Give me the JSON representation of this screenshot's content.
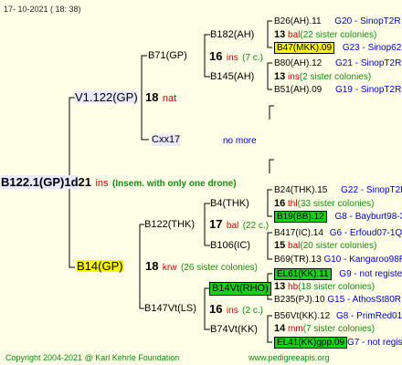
{
  "header": {
    "date": "17- 10-2021 ( 18: 38)"
  },
  "footer": {
    "copyright": "Copyright 2004-2021 @ Karl Kehrle Foundation",
    "url": "www.pedigreeapis.org"
  },
  "root": {
    "id": "B122.1(GP)1d",
    "num": "21",
    "code": "ins",
    "note": "(Insem. with only one drone)"
  },
  "gen1": {
    "top": {
      "id": "V1.122(GP)",
      "num": "18",
      "code": "nat"
    },
    "bottom": {
      "id": "B14(GP)",
      "num": "18",
      "code": "krw",
      "note": "(26 sister colonies)"
    }
  },
  "gen2": {
    "a": {
      "id": "B71(GP)",
      "num": "16",
      "code": "ins",
      "note": "(7 c.)"
    },
    "b": {
      "id": "Cxx17",
      "note": "no more"
    },
    "c": {
      "id": "B122(THK)",
      "num": "17",
      "code": "bal",
      "note": "(22 c.)"
    },
    "d": {
      "id": "B147Vt(LS)",
      "num": "16",
      "code": "ins",
      "note": "(2 c.)"
    }
  },
  "gen3": {
    "a1": {
      "id": "B182(AH)"
    },
    "a2": {
      "id": "B145(AH)"
    },
    "c1": {
      "id": "B4(THK)"
    },
    "c2": {
      "id": "B106(IC)"
    },
    "d1": {
      "id": "B14Vt(RHO)"
    },
    "d2": {
      "id": "B74Vt(KK)"
    }
  },
  "gen4": [
    {
      "id": "B26(AH).11",
      "tag": "G20 - SinopT2R"
    },
    {
      "num": "13",
      "code": "bal",
      "note": "(22 sister colonies)"
    },
    {
      "id": "B47(MKK).09",
      "tag": "G23 - Sinop62R"
    },
    {
      "id": "B80(AH).12",
      "tag": "G21 - SinopT2R"
    },
    {
      "num": "13",
      "code": "ins",
      "note": "(2 sister colonies)"
    },
    {
      "id": "B51(AH).09",
      "tag": "G19 - SinopT2R"
    },
    {
      "id": "B24(THK).15",
      "tag": "G22 - SinopT2R"
    },
    {
      "num": "16",
      "code": "thl",
      "note": "(33 sister colonies)"
    },
    {
      "id": "B19(BB).12",
      "tag": "G8 - Bayburt98-3"
    },
    {
      "id": "B417(IC).14",
      "tag": "G6 - Erfoud07-1Q"
    },
    {
      "num": "15",
      "code": "bal",
      "note": "(20 sister colonies)"
    },
    {
      "id": "B69(TR).13",
      "tag": "G10 - Kangaroo98R"
    },
    {
      "id": "EL61(KK).11",
      "tag": "G9 - not registe"
    },
    {
      "num": "13",
      "code": "hb",
      "note": "(18 sister colonies)"
    },
    {
      "id": "B235(PJ).10",
      "tag": "G15 - AthosSt80R"
    },
    {
      "id": "B56Vt(KK).12",
      "tag": "G8 - PrimRed01"
    },
    {
      "num": "14",
      "code": "mm",
      "note": "(7 sister colonies)"
    },
    {
      "id": "EL41(KK)gpp.09",
      "tag": "G7 - not registe"
    }
  ],
  "colors": {
    "background": "#ffffe8",
    "red_code": "#cc0000",
    "blue_tag": "#0000cc",
    "highlight_yellow": "#f7f700",
    "highlight_green": "#19d019",
    "highlight_lavender": "#e8e8ff",
    "footer": "#0a8a0a"
  }
}
